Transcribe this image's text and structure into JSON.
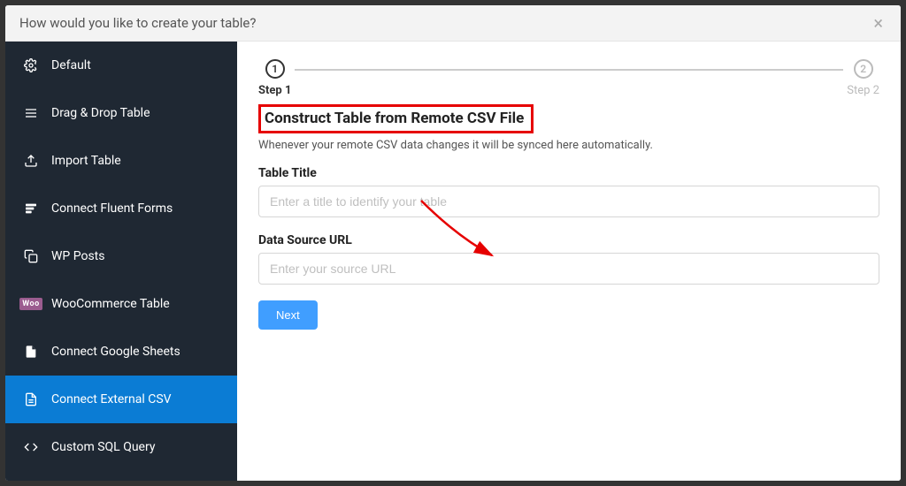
{
  "modal": {
    "title": "How would you like to create your table?"
  },
  "sidebar": {
    "items": [
      {
        "label": "Default"
      },
      {
        "label": "Drag & Drop Table"
      },
      {
        "label": "Import Table"
      },
      {
        "label": "Connect Fluent Forms"
      },
      {
        "label": "WP Posts"
      },
      {
        "label": "WooCommerce Table"
      },
      {
        "label": "Connect Google Sheets"
      },
      {
        "label": "Connect External CSV"
      },
      {
        "label": "Custom SQL Query"
      }
    ]
  },
  "stepper": {
    "step1": {
      "num": "1",
      "label": "Step 1"
    },
    "step2": {
      "num": "2",
      "label": "Step 2"
    }
  },
  "main": {
    "heading": "Construct Table from Remote CSV File",
    "sub": "Whenever your remote CSV data changes it will be synced here automatically.",
    "title_label": "Table Title",
    "title_placeholder": "Enter a title to identify your table",
    "url_label": "Data Source URL",
    "url_placeholder": "Enter your source URL",
    "next_label": "Next"
  }
}
